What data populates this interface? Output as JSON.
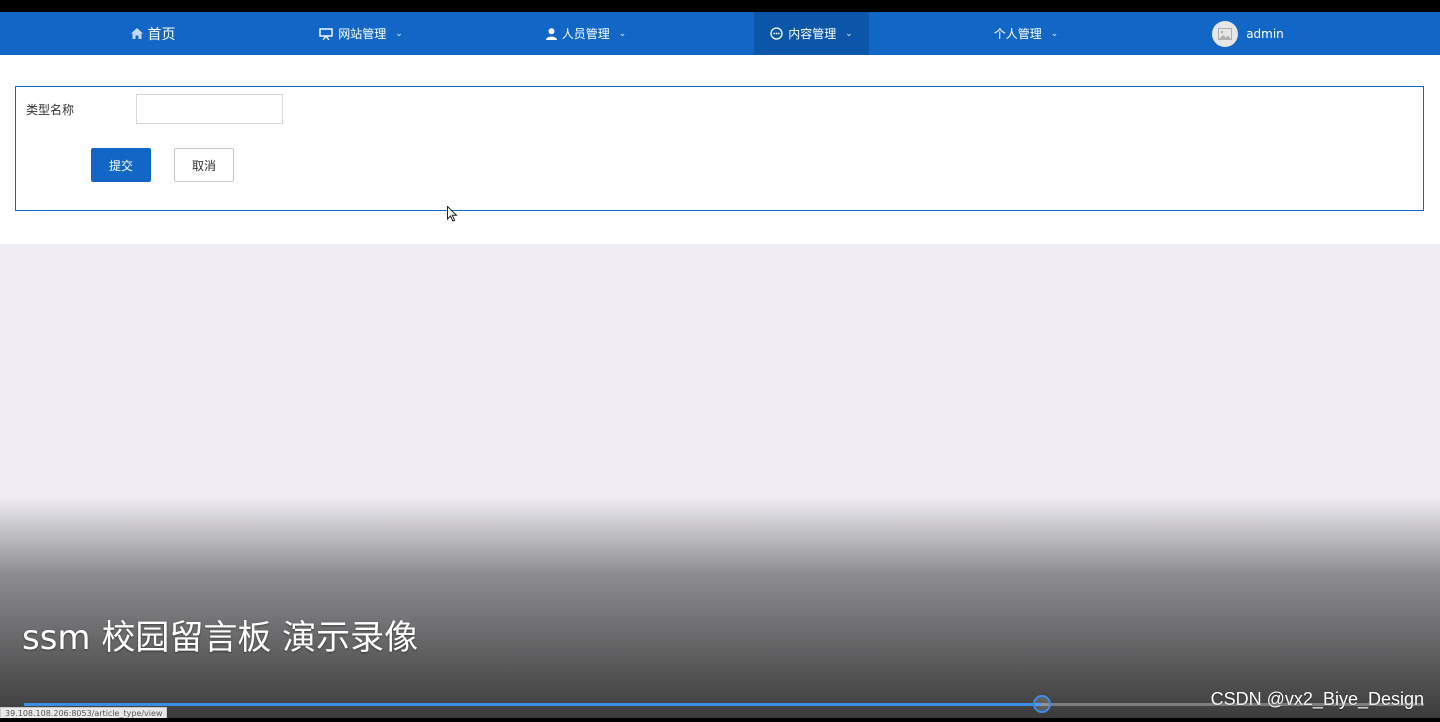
{
  "nav": {
    "home": "首页",
    "site": "网站管理",
    "people": "人员管理",
    "content": "内容管理",
    "personal": "个人管理",
    "user": "admin"
  },
  "form": {
    "label": "类型名称",
    "input_value": "",
    "submit": "提交",
    "cancel": "取消"
  },
  "video": {
    "caption": "ssm 校园留言板 演示录像",
    "watermark": "CSDN @vx2_Biye_Design",
    "progress": 0.727
  },
  "status_url": "39.108.108.206:8053/article_type/view",
  "colors": {
    "nav_bg": "#1267c6",
    "nav_active_bg": "#0b56a8",
    "primary": "#1267c6",
    "progress": "#3a8ee6"
  },
  "icons": {
    "home": "home-icon",
    "site": "monitor-icon",
    "people": "user-icon",
    "content": "chat-icon",
    "avatar": "image-icon"
  }
}
